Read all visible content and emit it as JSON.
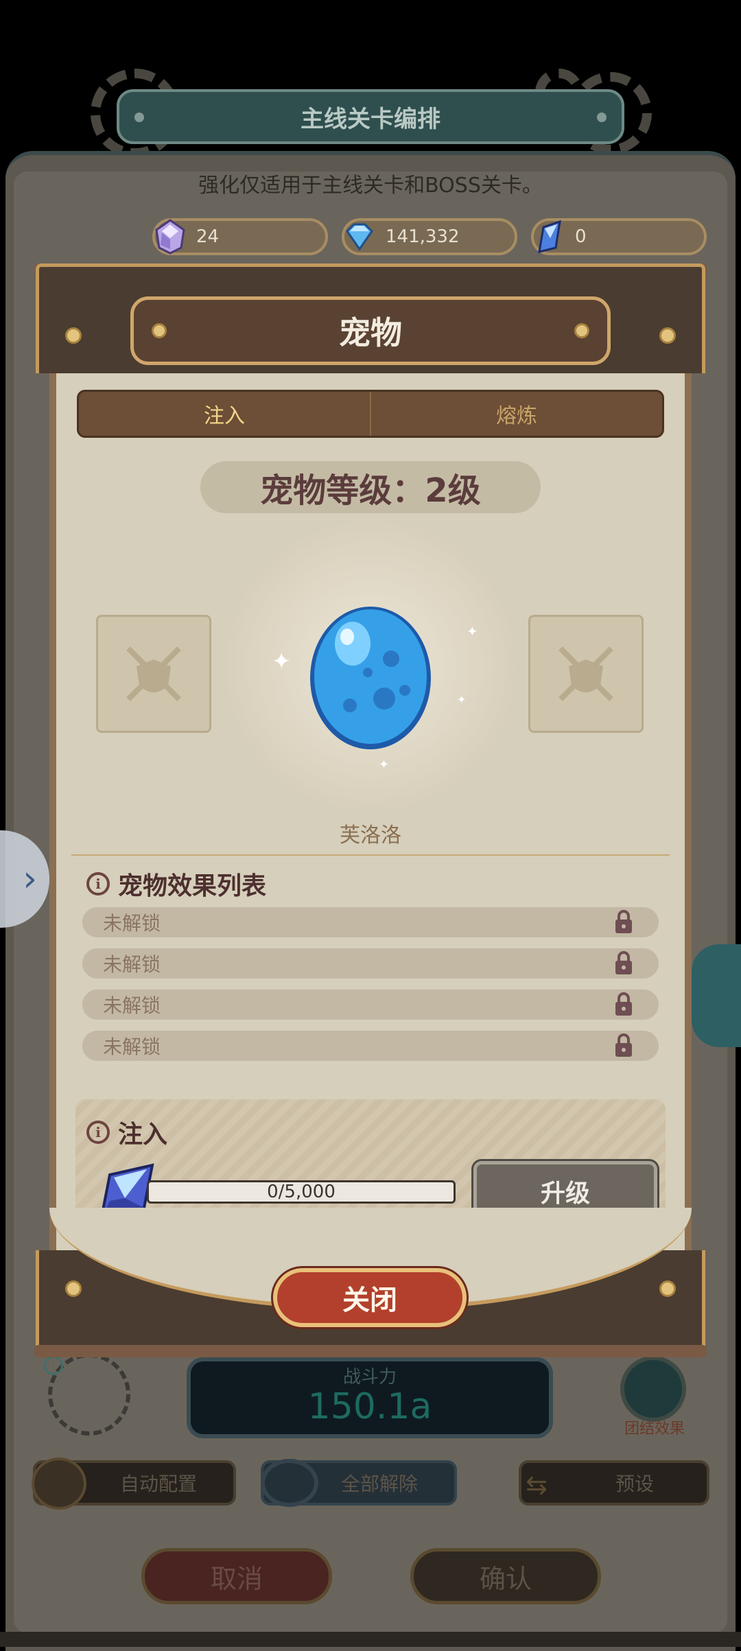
{
  "background": {
    "banner_title": "主线关卡编排",
    "subtitle": "强化仅适用于主线关卡和BOSS关卡。",
    "currencies": [
      {
        "icon": "purple-crystal-icon",
        "value": "24"
      },
      {
        "icon": "blue-diamond-icon",
        "value": "141,332"
      },
      {
        "icon": "blue-shard-icon",
        "value": "0"
      }
    ],
    "power_label": "战斗力",
    "power_value": "150.1a",
    "team_effect_label": "团结效果",
    "buttons": {
      "auto_config": "自动配置",
      "remove_all": "全部解除",
      "preset": "预设",
      "cancel": "取消",
      "confirm": "确认"
    }
  },
  "modal": {
    "title": "宠物",
    "tabs": [
      {
        "label": "注入",
        "active": true
      },
      {
        "label": "熔炼",
        "active": false
      }
    ],
    "level_text": "宠物等级：2级",
    "pet_name": "芙洛洛",
    "effects_title": "宠物效果列表",
    "effects": [
      {
        "label": "未解锁",
        "icon": "lock-icon"
      },
      {
        "label": "未解锁",
        "icon": "lock-icon"
      },
      {
        "label": "未解锁",
        "icon": "lock-icon"
      },
      {
        "label": "未解锁",
        "icon": "lock-icon"
      }
    ],
    "inject": {
      "title": "注入",
      "progress_text": "0/5,000",
      "progress_fraction": 0,
      "upgrade_label": "升级"
    },
    "close_label": "关闭"
  },
  "colors": {
    "accent_gold": "#c59b5d",
    "modal_paper": "#d6cfbb",
    "close_red": "#b2402c",
    "egg_blue": "#35a0e8"
  }
}
